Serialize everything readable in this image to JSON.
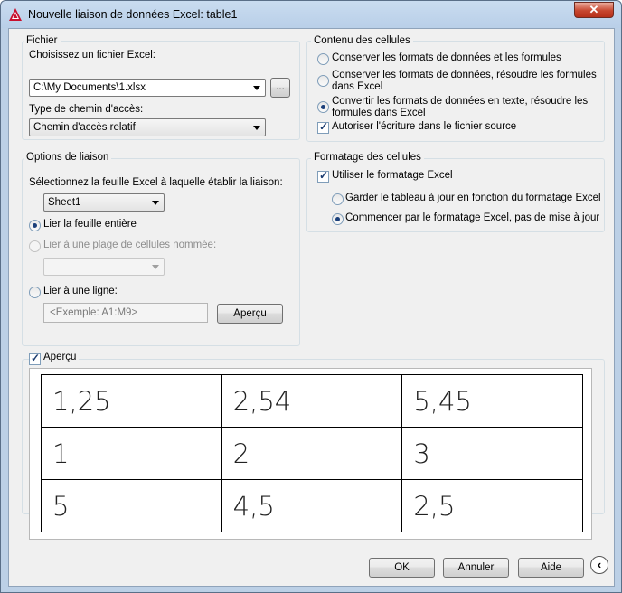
{
  "window": {
    "title": "Nouvelle liaison de données Excel: table1",
    "close_label": "✕"
  },
  "fichier": {
    "group_label": "Fichier",
    "choose_label": "Choisissez un fichier Excel:",
    "file_value": "C:\\My Documents\\1.xlsx",
    "browse_label": "...",
    "path_type_label": "Type de chemin d'accès:",
    "path_type_value": "Chemin d'accès relatif"
  },
  "contenu": {
    "group_label": "Contenu des cellules",
    "opt1": "Conserver les formats de données et les formules",
    "opt2_line1": "Conserver les formats de données, résoudre les formules",
    "opt2_line2": "dans Excel",
    "opt3_line1": "Convertir les formats de données en texte, résoudre les",
    "opt3_line2": "formules dans Excel",
    "allow_write": "Autoriser l'écriture dans le fichier source"
  },
  "liaison": {
    "group_label": "Options de liaison",
    "select_sheet_label": "Sélectionnez la feuille Excel à laquelle établir la liaison:",
    "sheet_value": "Sheet1",
    "link_whole_sheet": "Lier la feuille entière",
    "link_named_range": "Lier à une plage de cellules nommée:",
    "link_range": "Lier à une ligne:",
    "range_placeholder": "<Exemple: A1:M9>",
    "preview_button": "Aperçu"
  },
  "formatage": {
    "group_label": "Formatage des cellules",
    "use_excel_format": "Utiliser le formatage Excel",
    "keep_updated": "Garder le tableau à jour en fonction du formatage Excel",
    "start_with_excel": "Commencer par le formatage Excel, pas de mise à jour"
  },
  "apercu": {
    "label": "Aperçu",
    "rows": [
      [
        "1,25",
        "2,54",
        "5,45"
      ],
      [
        "1",
        "2",
        "3"
      ],
      [
        "5",
        "4,5",
        "2,5"
      ]
    ]
  },
  "footer": {
    "ok": "OK",
    "cancel": "Annuler",
    "help": "Aide",
    "nav_icon": "chevron-left-icon"
  }
}
